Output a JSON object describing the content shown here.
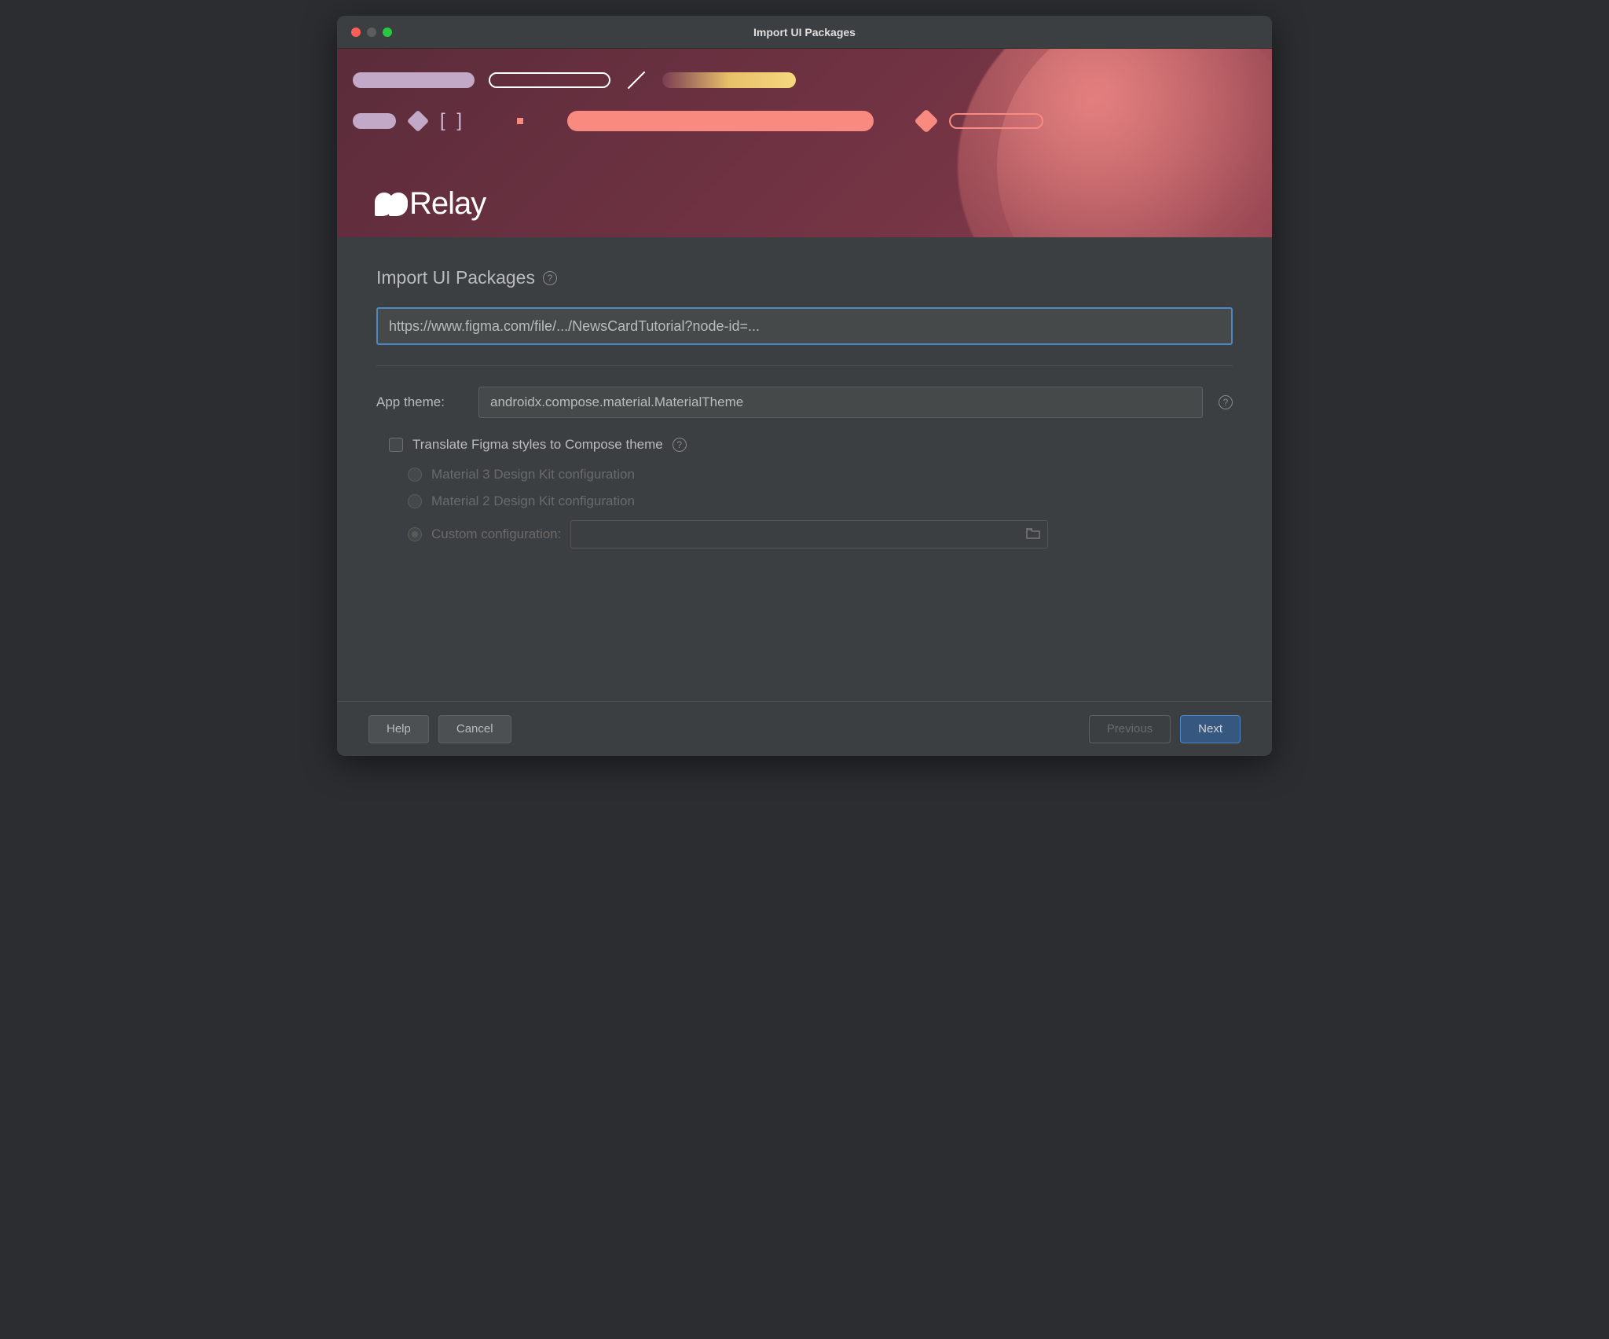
{
  "window": {
    "title": "Import UI Packages"
  },
  "hero": {
    "brand": "Relay"
  },
  "section": {
    "title": "Import UI Packages"
  },
  "form": {
    "url_value": "https://www.figma.com/file/.../NewsCardTutorial?node-id=...",
    "app_theme_label": "App theme:",
    "app_theme_value": "androidx.compose.material.MaterialTheme",
    "translate_label": "Translate Figma styles to Compose theme",
    "radios": {
      "m3": "Material 3 Design Kit configuration",
      "m2": "Material 2 Design Kit configuration",
      "custom": "Custom configuration:"
    }
  },
  "footer": {
    "help": "Help",
    "cancel": "Cancel",
    "previous": "Previous",
    "next": "Next"
  }
}
